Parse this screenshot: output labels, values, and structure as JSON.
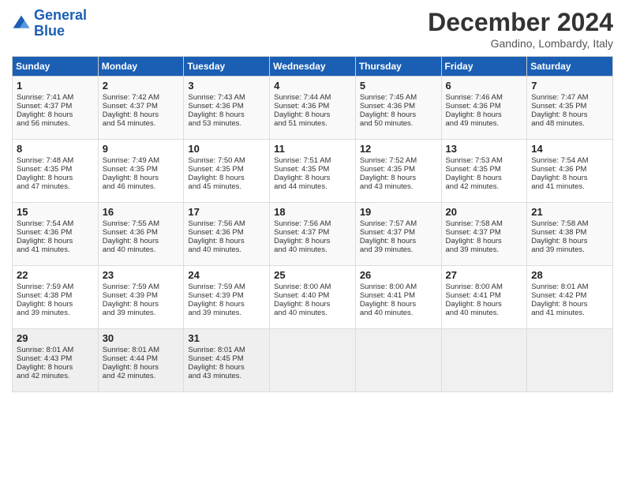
{
  "header": {
    "logo_line1": "General",
    "logo_line2": "Blue",
    "month": "December 2024",
    "location": "Gandino, Lombardy, Italy"
  },
  "weekdays": [
    "Sunday",
    "Monday",
    "Tuesday",
    "Wednesday",
    "Thursday",
    "Friday",
    "Saturday"
  ],
  "weeks": [
    [
      {
        "day": "1",
        "lines": [
          "Sunrise: 7:41 AM",
          "Sunset: 4:37 PM",
          "Daylight: 8 hours",
          "and 56 minutes."
        ]
      },
      {
        "day": "2",
        "lines": [
          "Sunrise: 7:42 AM",
          "Sunset: 4:37 PM",
          "Daylight: 8 hours",
          "and 54 minutes."
        ]
      },
      {
        "day": "3",
        "lines": [
          "Sunrise: 7:43 AM",
          "Sunset: 4:36 PM",
          "Daylight: 8 hours",
          "and 53 minutes."
        ]
      },
      {
        "day": "4",
        "lines": [
          "Sunrise: 7:44 AM",
          "Sunset: 4:36 PM",
          "Daylight: 8 hours",
          "and 51 minutes."
        ]
      },
      {
        "day": "5",
        "lines": [
          "Sunrise: 7:45 AM",
          "Sunset: 4:36 PM",
          "Daylight: 8 hours",
          "and 50 minutes."
        ]
      },
      {
        "day": "6",
        "lines": [
          "Sunrise: 7:46 AM",
          "Sunset: 4:36 PM",
          "Daylight: 8 hours",
          "and 49 minutes."
        ]
      },
      {
        "day": "7",
        "lines": [
          "Sunrise: 7:47 AM",
          "Sunset: 4:35 PM",
          "Daylight: 8 hours",
          "and 48 minutes."
        ]
      }
    ],
    [
      {
        "day": "8",
        "lines": [
          "Sunrise: 7:48 AM",
          "Sunset: 4:35 PM",
          "Daylight: 8 hours",
          "and 47 minutes."
        ]
      },
      {
        "day": "9",
        "lines": [
          "Sunrise: 7:49 AM",
          "Sunset: 4:35 PM",
          "Daylight: 8 hours",
          "and 46 minutes."
        ]
      },
      {
        "day": "10",
        "lines": [
          "Sunrise: 7:50 AM",
          "Sunset: 4:35 PM",
          "Daylight: 8 hours",
          "and 45 minutes."
        ]
      },
      {
        "day": "11",
        "lines": [
          "Sunrise: 7:51 AM",
          "Sunset: 4:35 PM",
          "Daylight: 8 hours",
          "and 44 minutes."
        ]
      },
      {
        "day": "12",
        "lines": [
          "Sunrise: 7:52 AM",
          "Sunset: 4:35 PM",
          "Daylight: 8 hours",
          "and 43 minutes."
        ]
      },
      {
        "day": "13",
        "lines": [
          "Sunrise: 7:53 AM",
          "Sunset: 4:35 PM",
          "Daylight: 8 hours",
          "and 42 minutes."
        ]
      },
      {
        "day": "14",
        "lines": [
          "Sunrise: 7:54 AM",
          "Sunset: 4:36 PM",
          "Daylight: 8 hours",
          "and 41 minutes."
        ]
      }
    ],
    [
      {
        "day": "15",
        "lines": [
          "Sunrise: 7:54 AM",
          "Sunset: 4:36 PM",
          "Daylight: 8 hours",
          "and 41 minutes."
        ]
      },
      {
        "day": "16",
        "lines": [
          "Sunrise: 7:55 AM",
          "Sunset: 4:36 PM",
          "Daylight: 8 hours",
          "and 40 minutes."
        ]
      },
      {
        "day": "17",
        "lines": [
          "Sunrise: 7:56 AM",
          "Sunset: 4:36 PM",
          "Daylight: 8 hours",
          "and 40 minutes."
        ]
      },
      {
        "day": "18",
        "lines": [
          "Sunrise: 7:56 AM",
          "Sunset: 4:37 PM",
          "Daylight: 8 hours",
          "and 40 minutes."
        ]
      },
      {
        "day": "19",
        "lines": [
          "Sunrise: 7:57 AM",
          "Sunset: 4:37 PM",
          "Daylight: 8 hours",
          "and 39 minutes."
        ]
      },
      {
        "day": "20",
        "lines": [
          "Sunrise: 7:58 AM",
          "Sunset: 4:37 PM",
          "Daylight: 8 hours",
          "and 39 minutes."
        ]
      },
      {
        "day": "21",
        "lines": [
          "Sunrise: 7:58 AM",
          "Sunset: 4:38 PM",
          "Daylight: 8 hours",
          "and 39 minutes."
        ]
      }
    ],
    [
      {
        "day": "22",
        "lines": [
          "Sunrise: 7:59 AM",
          "Sunset: 4:38 PM",
          "Daylight: 8 hours",
          "and 39 minutes."
        ]
      },
      {
        "day": "23",
        "lines": [
          "Sunrise: 7:59 AM",
          "Sunset: 4:39 PM",
          "Daylight: 8 hours",
          "and 39 minutes."
        ]
      },
      {
        "day": "24",
        "lines": [
          "Sunrise: 7:59 AM",
          "Sunset: 4:39 PM",
          "Daylight: 8 hours",
          "and 39 minutes."
        ]
      },
      {
        "day": "25",
        "lines": [
          "Sunrise: 8:00 AM",
          "Sunset: 4:40 PM",
          "Daylight: 8 hours",
          "and 40 minutes."
        ]
      },
      {
        "day": "26",
        "lines": [
          "Sunrise: 8:00 AM",
          "Sunset: 4:41 PM",
          "Daylight: 8 hours",
          "and 40 minutes."
        ]
      },
      {
        "day": "27",
        "lines": [
          "Sunrise: 8:00 AM",
          "Sunset: 4:41 PM",
          "Daylight: 8 hours",
          "and 40 minutes."
        ]
      },
      {
        "day": "28",
        "lines": [
          "Sunrise: 8:01 AM",
          "Sunset: 4:42 PM",
          "Daylight: 8 hours",
          "and 41 minutes."
        ]
      }
    ],
    [
      {
        "day": "29",
        "lines": [
          "Sunrise: 8:01 AM",
          "Sunset: 4:43 PM",
          "Daylight: 8 hours",
          "and 42 minutes."
        ]
      },
      {
        "day": "30",
        "lines": [
          "Sunrise: 8:01 AM",
          "Sunset: 4:44 PM",
          "Daylight: 8 hours",
          "and 42 minutes."
        ]
      },
      {
        "day": "31",
        "lines": [
          "Sunrise: 8:01 AM",
          "Sunset: 4:45 PM",
          "Daylight: 8 hours",
          "and 43 minutes."
        ]
      },
      {
        "day": "",
        "lines": []
      },
      {
        "day": "",
        "lines": []
      },
      {
        "day": "",
        "lines": []
      },
      {
        "day": "",
        "lines": []
      }
    ]
  ]
}
